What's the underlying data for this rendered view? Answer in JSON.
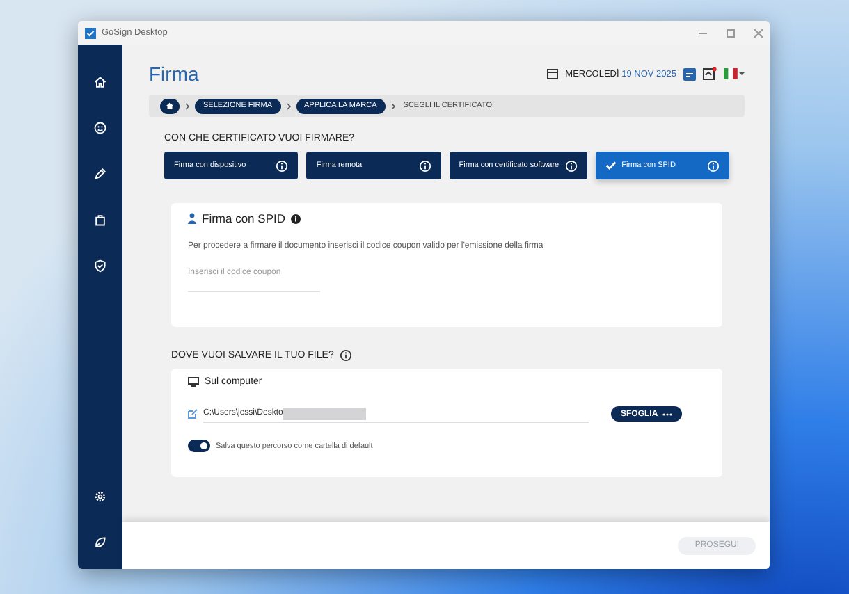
{
  "window": {
    "title": "GoSign Desktop"
  },
  "header": {
    "title": "Firma",
    "weekday": "MERCOLEDÌ",
    "date": "19 NOV 2025"
  },
  "breadcrumb": [
    {
      "label": "SELEZIONE FIRMA",
      "done": true
    },
    {
      "label": "APPLICA LA MARCA",
      "done": true
    },
    {
      "label": "SCEGLI IL CERTIFICATO",
      "done": false
    }
  ],
  "certificate": {
    "question": "CON CHE CERTIFICATO VUOI FIRMARE?",
    "options": [
      {
        "label": "Firma con dispositivo",
        "selected": false
      },
      {
        "label": "Firma remota",
        "selected": false
      },
      {
        "label": "Firma con certificato software",
        "selected": false
      },
      {
        "label": "Firma con SPID",
        "selected": true
      }
    ]
  },
  "spid_card": {
    "title": "Firma con SPID",
    "description": "Per procedere a firmare il documento inserisci il codice coupon valido per l'emissione della firma",
    "coupon_field": {
      "placeholder": "Inserisci il codice coupon"
    }
  },
  "save": {
    "heading": "DOVE VUOI SALVARE IL TUO FILE?",
    "option": "Sul computer",
    "path": "C:\\Users\\jessi\\Deskto",
    "browse_button": "SFOGLIA",
    "toggle": {
      "label": "Salva questo percorso come cartella di default",
      "on": true
    }
  },
  "footer": {
    "next_button": {
      "label": "PROSEGUI",
      "disabled": true
    }
  }
}
